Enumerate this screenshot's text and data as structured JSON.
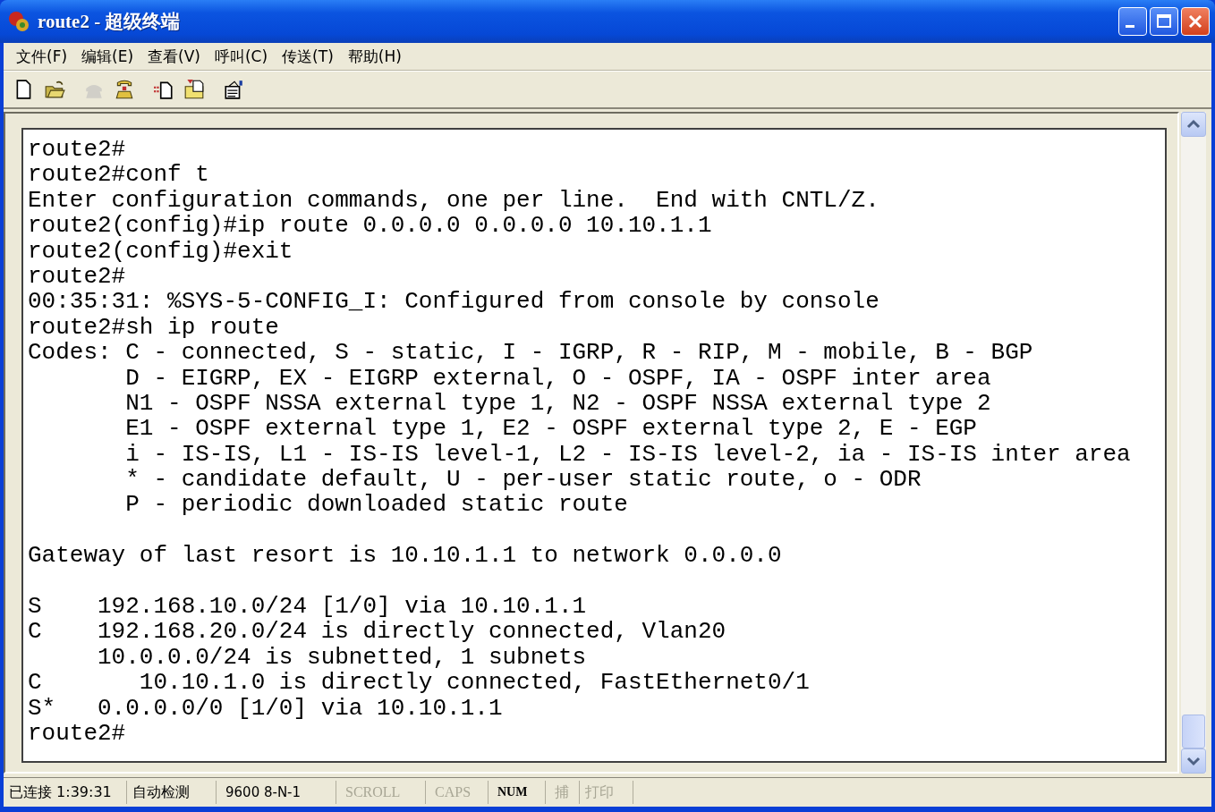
{
  "window": {
    "title": "route2 - 超级终端"
  },
  "menu": [
    {
      "label": "文件(F)"
    },
    {
      "label": "编辑(E)"
    },
    {
      "label": "查看(V)"
    },
    {
      "label": "呼叫(C)"
    },
    {
      "label": "传送(T)"
    },
    {
      "label": "帮助(H)"
    }
  ],
  "toolbar": [
    {
      "disabled": false
    },
    {
      "disabled": false
    },
    {
      "disabled": true
    },
    {
      "disabled": false
    },
    {
      "disabled": false
    },
    {
      "disabled": false
    },
    {
      "disabled": false
    }
  ],
  "terminal": {
    "blocks": [
      {
        "lines": [
          "route2#",
          "route2#conf t",
          "Enter configuration commands, one per line.  End with CNTL/Z.",
          "route2(config)#ip route 0.0.0.0 0.0.0.0 10.10.1.1",
          "route2(config)#exit",
          "route2#",
          "00:35:31: %SYS-5-CONFIG_I: Configured from console by console",
          "route2#sh ip route",
          "Codes: C - connected, S - static, I - IGRP, R - RIP, M - mobile, B - BGP",
          "       D - EIGRP, EX - EIGRP external, O - OSPF, IA - OSPF inter area",
          "       N1 - OSPF NSSA external type 1, N2 - OSPF NSSA external type 2",
          "       E1 - OSPF external type 1, E2 - OSPF external type 2, E - EGP",
          "       i - IS-IS, L1 - IS-IS level-1, L2 - IS-IS level-2, ia - IS-IS inter area",
          "       * - candidate default, U - per-user static route, o - ODR",
          "       P - periodic downloaded static route"
        ]
      },
      {
        "lines": [
          "Gateway of last resort is 10.10.1.1 to network 0.0.0.0"
        ]
      },
      {
        "lines": [
          "S    192.168.10.0/24 [1/0] via 10.10.1.1",
          "C    192.168.20.0/24 is directly connected, Vlan20",
          "     10.0.0.0/24 is subnetted, 1 subnets",
          "C       10.10.1.0 is directly connected, FastEthernet0/1",
          "S*   0.0.0.0/0 [1/0] via 10.10.1.1",
          "route2#"
        ]
      }
    ]
  },
  "status_bar": [
    {
      "text": "已连接 1:39:31",
      "active": true
    },
    {
      "text": "自动检测",
      "active": true
    },
    {
      "text": "9600 8-N-1",
      "active": true
    },
    {
      "text": "SCROLL",
      "active": false
    },
    {
      "text": "CAPS",
      "active": false
    },
    {
      "text": "NUM",
      "active": true
    },
    {
      "text": "捕",
      "active": false
    },
    {
      "text": "打印",
      "active": false
    }
  ]
}
